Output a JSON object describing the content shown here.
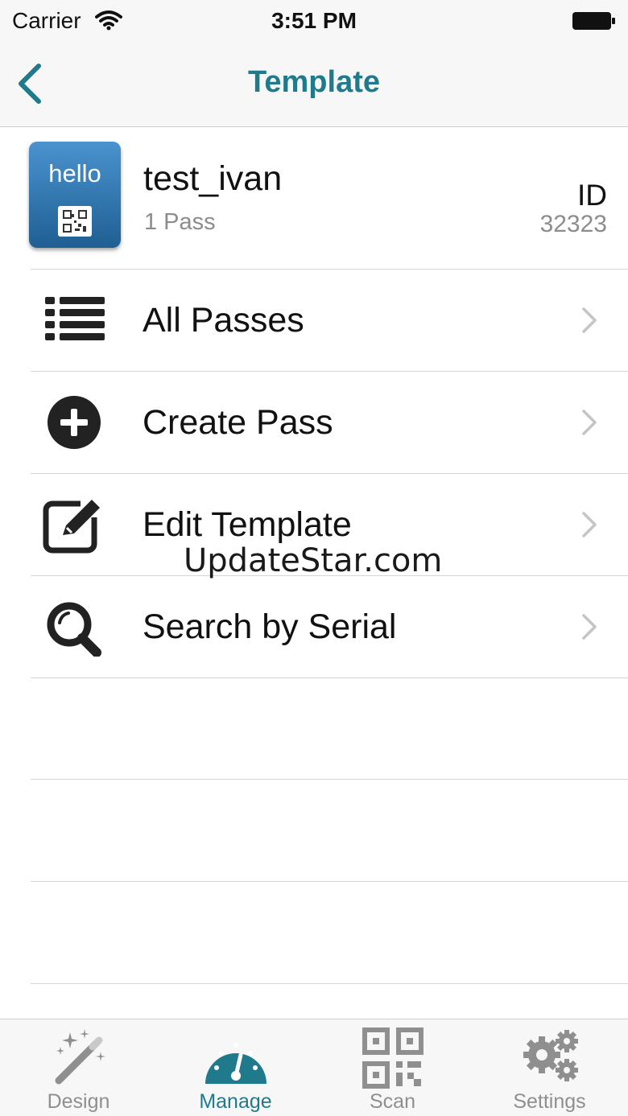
{
  "status": {
    "carrier": "Carrier",
    "time": "3:51 PM"
  },
  "nav": {
    "title": "Template",
    "accent": "#1f7a8c"
  },
  "template": {
    "thumb_text": "hello",
    "name": "test_ivan",
    "pass_count": "1 Pass",
    "id_label": "ID",
    "id_value": "32323"
  },
  "menu": [
    {
      "label": "All Passes",
      "icon": "list-icon"
    },
    {
      "label": "Create Pass",
      "icon": "plus-circle-icon"
    },
    {
      "label": "Edit Template",
      "icon": "edit-icon"
    },
    {
      "label": "Search by Serial",
      "icon": "search-icon"
    }
  ],
  "watermark": "UpdateStar.com",
  "tabs": [
    {
      "label": "Design",
      "icon": "magic-wand-icon",
      "active": false
    },
    {
      "label": "Manage",
      "icon": "speedometer-icon",
      "active": true
    },
    {
      "label": "Scan",
      "icon": "qr-code-icon",
      "active": false
    },
    {
      "label": "Settings",
      "icon": "gears-icon",
      "active": false
    }
  ]
}
